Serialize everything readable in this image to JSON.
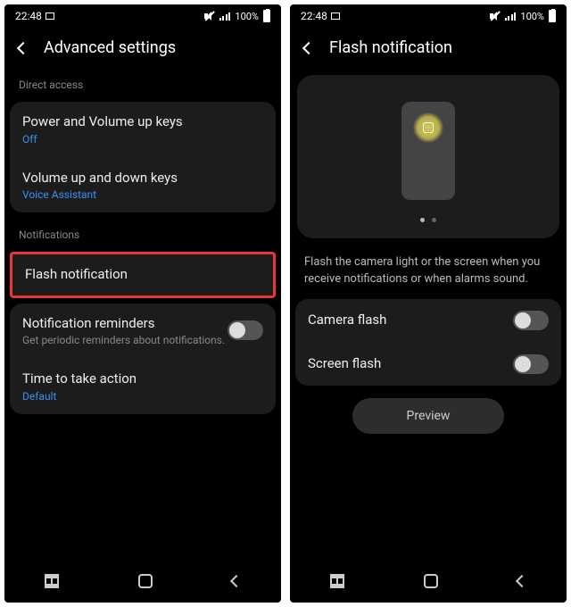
{
  "statusbar": {
    "time": "22:48",
    "battery_pct": "100%"
  },
  "left": {
    "title": "Advanced settings",
    "section1_label": "Direct access",
    "row1": {
      "title": "Power and Volume up keys",
      "sub": "Off"
    },
    "row2": {
      "title": "Volume up and down keys",
      "sub": "Voice Assistant"
    },
    "section2_label": "Notifications",
    "row3": {
      "title": "Flash notification"
    },
    "row4": {
      "title": "Notification reminders",
      "sub": "Get periodic reminders about notifications."
    },
    "row5": {
      "title": "Time to take action",
      "sub": "Default"
    }
  },
  "right": {
    "title": "Flash notification",
    "desc": "Flash the camera light or the screen when you receive notifications or when alarms sound.",
    "row1": {
      "title": "Camera flash"
    },
    "row2": {
      "title": "Screen flash"
    },
    "preview_btn": "Preview"
  }
}
